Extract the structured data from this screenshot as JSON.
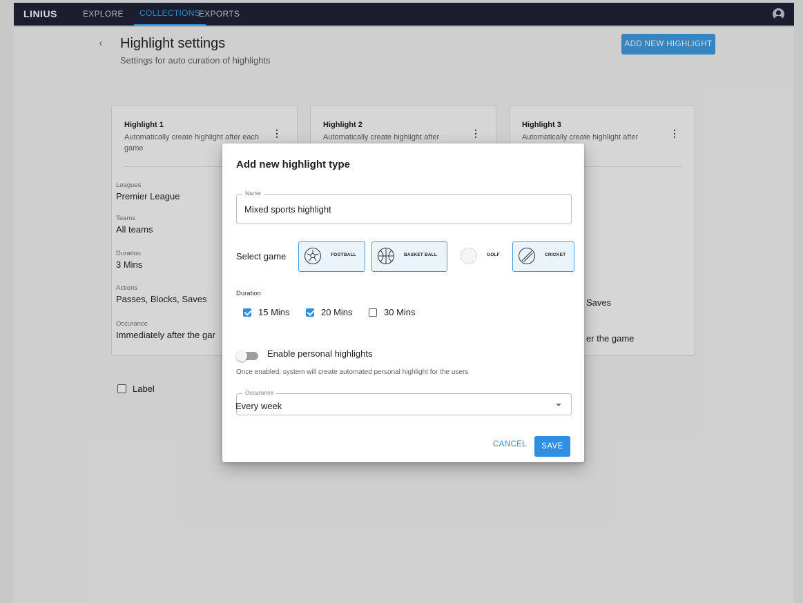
{
  "brand": {
    "name": "LINIUS"
  },
  "nav": {
    "items": [
      "EXPLORE",
      "COLLECTIONS",
      "EXPORTS"
    ],
    "active": "COLLECTIONS"
  },
  "header": {
    "title": "Highlight settings",
    "subtitle": "Settings for auto curation of highlights",
    "add_button": "ADD NEW HIGHLIGHT",
    "back_icon": "chevron-left-icon"
  },
  "cards": [
    {
      "title": "Highlight 1",
      "description": "Automatically create highlight after each game",
      "fields": [
        {
          "label": "Leagues",
          "value": "Premier League"
        },
        {
          "label": "Teams",
          "value": "All teams"
        },
        {
          "label": "Duration",
          "value": "3 Mins"
        },
        {
          "label": "Actions",
          "value": "Passes, Blocks, Saves"
        },
        {
          "label": "Occurance",
          "value": "Immediately after the gar"
        }
      ]
    },
    {
      "title": "Highlight 2",
      "description": "Automatically create highlight after"
    },
    {
      "title": "Highlight 3",
      "description": "Automatically create highlight after",
      "visible_values": {
        "actions": "Saves",
        "occurance": "er the game"
      }
    }
  ],
  "label_checkbox": {
    "label": "Label",
    "checked": false
  },
  "dialog": {
    "title": "Add new highlight type",
    "name_field": {
      "label": "Name",
      "value": "Mixed sports highlight"
    },
    "select_game_label": "Select game",
    "games": [
      {
        "label": "FOOTBALL",
        "selected": true,
        "icon": "football-icon"
      },
      {
        "label": "BASKET BALL",
        "selected": true,
        "icon": "basketball-icon"
      },
      {
        "label": "GOLF",
        "selected": false,
        "icon": "golf-ball-icon"
      },
      {
        "label": "CRICKET",
        "selected": true,
        "icon": "cricket-ball-icon"
      }
    ],
    "duration_label": "Duration",
    "durations": [
      {
        "label": "15 Mins",
        "checked": true
      },
      {
        "label": "20 Mins",
        "checked": true
      },
      {
        "label": "30 Mins",
        "checked": false
      }
    ],
    "toggle": {
      "label": "Enable personal highlights",
      "enabled": false,
      "help": "Once enabled, system will create automated personal highlight for the users"
    },
    "occurance": {
      "label": "Occurance",
      "value": "Every week"
    },
    "cancel": "CANCEL",
    "save": "SAVE"
  },
  "colors": {
    "accent": "#2f8ee0",
    "topbar": "#1f2337"
  }
}
